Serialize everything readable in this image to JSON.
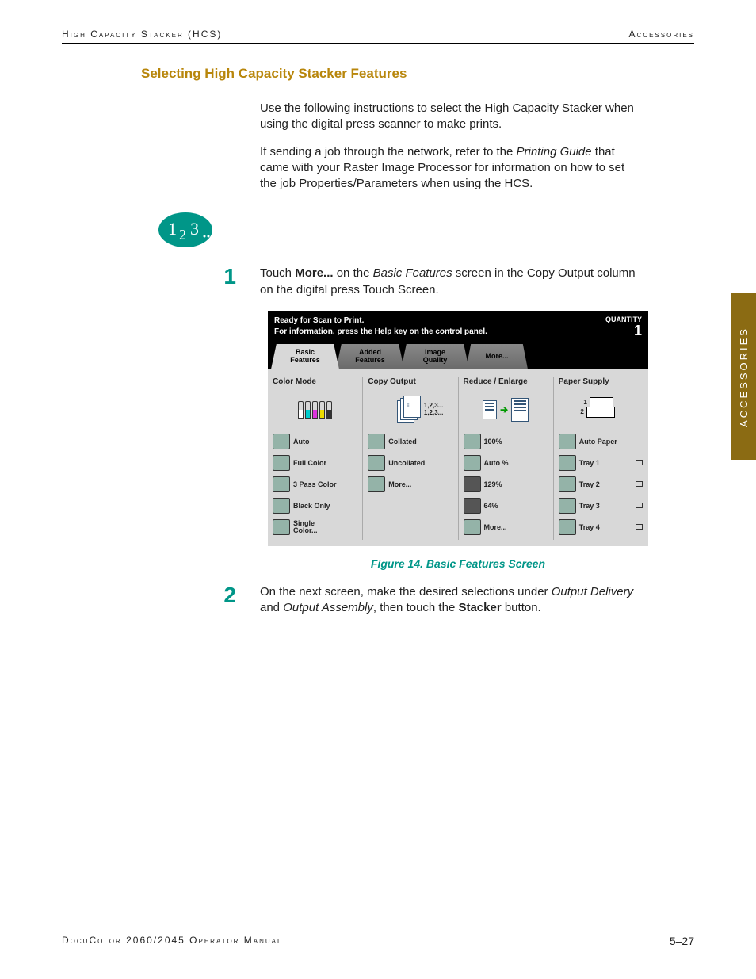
{
  "header": {
    "left": "High Capacity Stacker (HCS)",
    "right": "Accessories"
  },
  "section_title": "Selecting High Capacity Stacker Features",
  "para1": "Use the following instructions to select the High Capacity Stacker when using the digital press scanner to make prints.",
  "para2_a": "If sending a job through the network, refer to the ",
  "para2_i": "Printing Guide",
  "para2_b": " that came with your Raster Image Processor for information on how to set the job Properties/Parameters when using the HCS.",
  "steps": {
    "1": {
      "num": "1",
      "a": "Touch ",
      "b": "More...",
      "c": " on the ",
      "i": "Basic Features",
      "d": " screen in the Copy Output column on the digital press Touch Screen."
    },
    "2": {
      "num": "2",
      "a": "On the next screen, make the desired selections under ",
      "i1": "Output Delivery",
      "b": " and ",
      "i2": "Output Assembly",
      "c": ", then touch the ",
      "bold": "Stacker",
      "d": " button."
    }
  },
  "figure_caption": "Figure 14. Basic Features Screen",
  "side_tab": "ACCESSORIES",
  "footer": {
    "left": "DocuColor 2060/2045 Operator Manual",
    "right": "5–27"
  },
  "touchscreen": {
    "status_line1": "Ready for Scan to Print.",
    "status_line2": "For information, press the Help key on the control panel.",
    "qty_label": "QUANTITY",
    "qty_value": "1",
    "tabs": [
      "Basic\nFeatures",
      "Added\nFeatures",
      "Image\nQuality",
      "More..."
    ],
    "cols": {
      "color_mode": {
        "title": "Color Mode",
        "opts": [
          "Auto",
          "Full Color",
          "3 Pass Color",
          "Black Only",
          "Single\nColor..."
        ]
      },
      "copy_output": {
        "title": "Copy Output",
        "nums": "1,2,3...\n1,2,3...",
        "opts": [
          "Collated",
          "Uncollated",
          "More..."
        ]
      },
      "reduce_enlarge": {
        "title": "Reduce / Enlarge",
        "opts": [
          "100%",
          "Auto %",
          "129%",
          "64%",
          "More..."
        ]
      },
      "paper_supply": {
        "title": "Paper Supply",
        "tray1": "1",
        "tray2": "2",
        "opts": [
          "Auto Paper",
          "Tray 1",
          "Tray 2",
          "Tray 3",
          "Tray 4"
        ]
      }
    }
  }
}
